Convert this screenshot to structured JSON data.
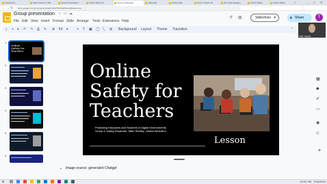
{
  "browser": {
    "tabs": [
      {
        "label": "Assessmen"
      },
      {
        "label": "Sam's Screen / Slid"
      },
      {
        "label": "Group Presentation"
      },
      {
        "label": "Online Safety for"
      },
      {
        "label": "Group presentatio"
      },
      {
        "label": "Safety Ed"
      },
      {
        "label": "Online Safe"
      },
      {
        "label": "How to Teach On"
      },
      {
        "label": "All media category"
      },
      {
        "label": "Online Safety"
      },
      {
        "label": "Online Safety"
      }
    ],
    "active_tab_index": 4,
    "url": "docs.google.com/presentation/d/1wUY8mPTMXHWhH/edit#slide=id.p"
  },
  "header": {
    "doc_title": "Group presentation",
    "menus": [
      "File",
      "Edit",
      "View",
      "Insert",
      "Format",
      "Slide",
      "Arrange",
      "Tools",
      "Extensions",
      "Help"
    ],
    "slideshow_label": "Slideshow",
    "share_label": "Share",
    "avatar_letter": "T",
    "webcam_name": "Tatlin Shelley"
  },
  "toolbar": {
    "zoom": "Fit",
    "background_label": "Background",
    "layout_label": "Layout",
    "theme_label": "Theme",
    "transition_label": "Transition"
  },
  "filmstrip": {
    "slide_numbers": [
      "1",
      "2",
      "3",
      "4",
      "5",
      "6"
    ],
    "thumb1_title": "Online\nSafety for\nTeachers"
  },
  "slide": {
    "title": "Online\nSafety for\nTeachers",
    "subtitle_line1": "Protecting Educators and Students in Digital Environments",
    "subtitle_line2": "Group 4: Hailey Rosander, Tatlin Shelley, Joshua McArthur",
    "lesson": "Lesson",
    "background_color": "#000000"
  },
  "notes": {
    "bullet": "•",
    "text": "Image source: generated Chatgpt"
  },
  "taskbar": {
    "time": "12:51 PM",
    "date": "7/16/2024"
  },
  "colors": {
    "accent_blue": "#0b57d0",
    "share_bg": "#c2e7ff",
    "slides_yellow": "#f4b400",
    "avatar_purple": "#9c27b0"
  }
}
